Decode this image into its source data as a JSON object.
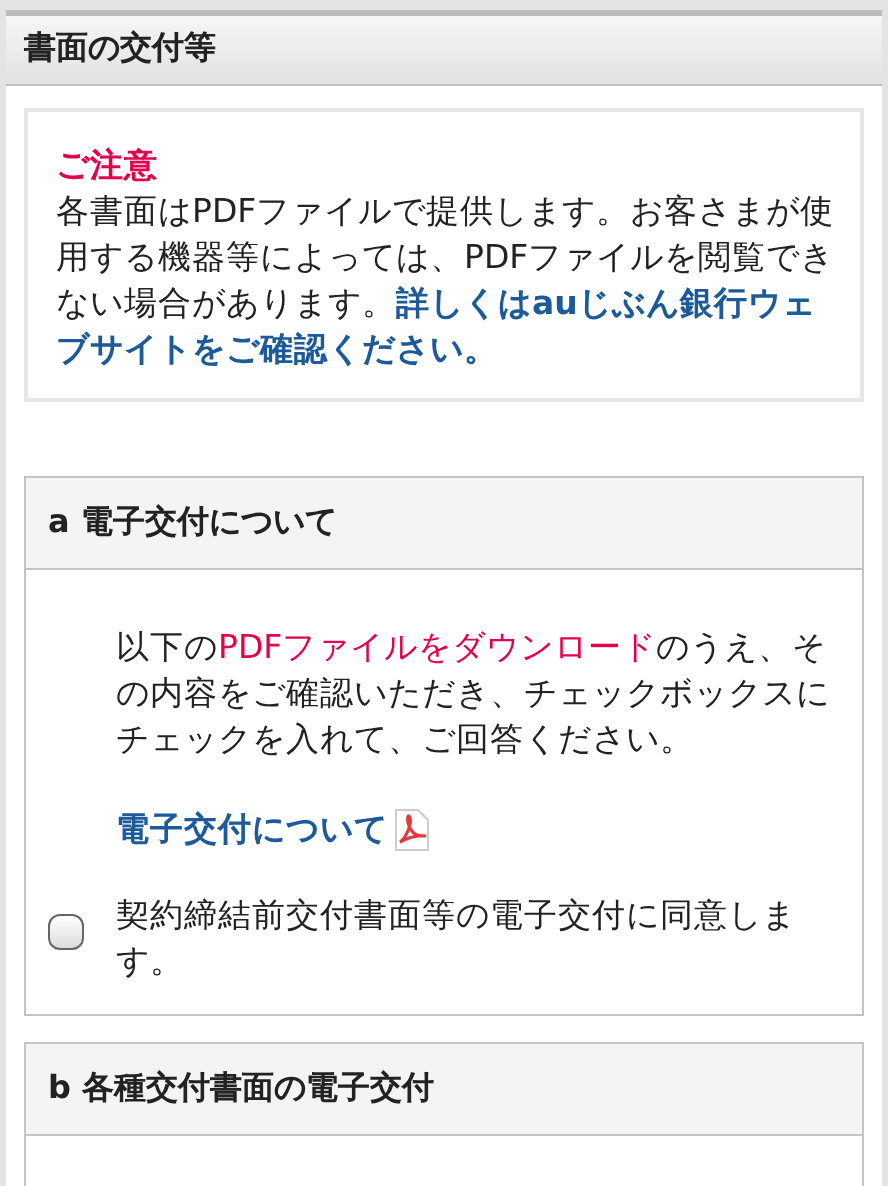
{
  "header": {
    "title": "書面の交付等"
  },
  "notice": {
    "title": "ご注意",
    "text": "各書面はPDFファイルで提供します。お客さまが使用する機器等によっては、PDFファイルを閲覧できない場合があります。",
    "link": "詳しくはauじぶん銀行ウェブサイトをご確認ください。"
  },
  "sections": [
    {
      "label": "a",
      "title": "電子交付について",
      "intro_before": "以下の",
      "intro_link": "PDFファイルをダウンロード",
      "intro_after": "のうえ、その内容をご確認いただき、チェックボックスにチェックを入れて、ご回答ください。",
      "doc_link": "電子交付について",
      "checkbox": {
        "label": "契約締結前交付書面等の電子交付に同意します。",
        "checked": false
      }
    },
    {
      "label": "b",
      "title": "各種交付書面の電子交付"
    }
  ]
}
